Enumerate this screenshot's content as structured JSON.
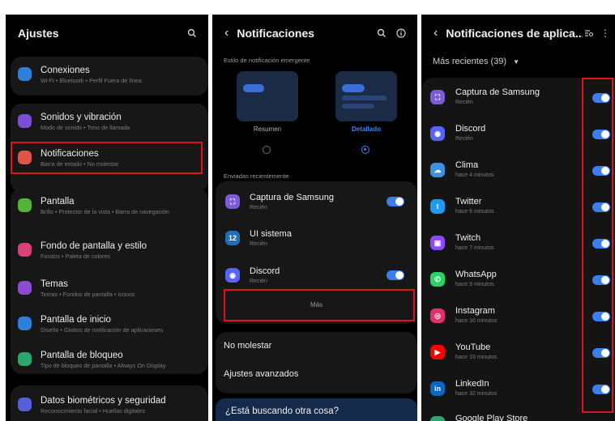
{
  "settings": {
    "title": "Ajustes",
    "items": [
      {
        "label": "Conexiones",
        "sub": "Wi-Fi • Bluetooth • Perfil Fuera de línea",
        "color": "#2f7fd8"
      },
      {
        "label": "Sonidos y vibración",
        "sub": "Modo de sonido • Tono de llamada",
        "color": "#7a4fd6"
      },
      {
        "label": "Notificaciones",
        "sub": "Barra de estado • No molestar",
        "color": "#e0554a"
      },
      {
        "label": "Pantalla",
        "sub": "Brillo • Protector de la vista • Barra de navegación",
        "color": "#55b33a"
      },
      {
        "label": "Fondo de pantalla y estilo",
        "sub": "Fondos • Paleta de colores",
        "color": "#d8417a"
      },
      {
        "label": "Temas",
        "sub": "Temas • Fondos de pantalla • Iconos",
        "color": "#8e4bd0"
      },
      {
        "label": "Pantalla de inicio",
        "sub": "Diseño • Globos de notificación de aplicaciones",
        "color": "#2f7fd8"
      },
      {
        "label": "Pantalla de bloqueo",
        "sub": "Tipo de bloqueo de pantalla • Always On Display",
        "color": "#2ea56c"
      },
      {
        "label": "Datos biométricos y seguridad",
        "sub": "Reconocimiento facial • Huellas digitales",
        "color": "#5560d8"
      }
    ]
  },
  "notifications": {
    "title": "Notificaciones",
    "popup_caption": "Estilo de notificación emergente",
    "style_options": [
      {
        "label": "Resumen",
        "selected": false
      },
      {
        "label": "Detallado",
        "selected": true
      }
    ],
    "recent_caption": "Enviadas recientemente",
    "recent": [
      {
        "name": "Captura de Samsung",
        "time": "Recién",
        "enabled": true,
        "color": "#7c5cd6",
        "glyph": "⛶"
      },
      {
        "name": "UI sistema",
        "time": "Recién",
        "enabled": false,
        "color": "#1e6fb8",
        "glyph": "12"
      },
      {
        "name": "Discord",
        "time": "Recién",
        "enabled": true,
        "color": "#5865f2",
        "glyph": "◉"
      }
    ],
    "more_label": "Más",
    "dnd": "No molestar",
    "advanced": "Ajustes avanzados",
    "search_prompt": "¿Está buscando otra cosa?"
  },
  "app_notifications": {
    "title": "Notificaciones de aplica...",
    "filter": "Más recientes (39)",
    "apps": [
      {
        "name": "Captura de Samsung",
        "time": "Recién",
        "color": "#7c5cd6",
        "glyph": "⛶",
        "enabled": true
      },
      {
        "name": "Discord",
        "time": "Recién",
        "color": "#5865f2",
        "glyph": "◉",
        "enabled": true
      },
      {
        "name": "Clima",
        "time": "hace 4 minutos",
        "color": "#3d8fe0",
        "glyph": "☁",
        "enabled": true
      },
      {
        "name": "Twitter",
        "time": "hace 6 minutos",
        "color": "#1d9bf0",
        "glyph": "t",
        "enabled": true
      },
      {
        "name": "Twitch",
        "time": "hace 7 minutos",
        "color": "#9146ff",
        "glyph": "▣",
        "enabled": true
      },
      {
        "name": "WhatsApp",
        "time": "hace 9 minutos",
        "color": "#25d366",
        "glyph": "✆",
        "enabled": true
      },
      {
        "name": "Instagram",
        "time": "hace 16 minutos",
        "color": "#e1306c",
        "glyph": "◎",
        "enabled": true
      },
      {
        "name": "YouTube",
        "time": "hace 19 minutos",
        "color": "#ff0000",
        "glyph": "▶",
        "enabled": true
      },
      {
        "name": "LinkedIn",
        "time": "hace 32 minutos",
        "color": "#0a66c2",
        "glyph": "in",
        "enabled": true
      },
      {
        "name": "Google Play Store",
        "time": "",
        "color": "#2ea56c",
        "glyph": "▶",
        "enabled": true
      }
    ]
  },
  "highlight_color": "#e0121b"
}
